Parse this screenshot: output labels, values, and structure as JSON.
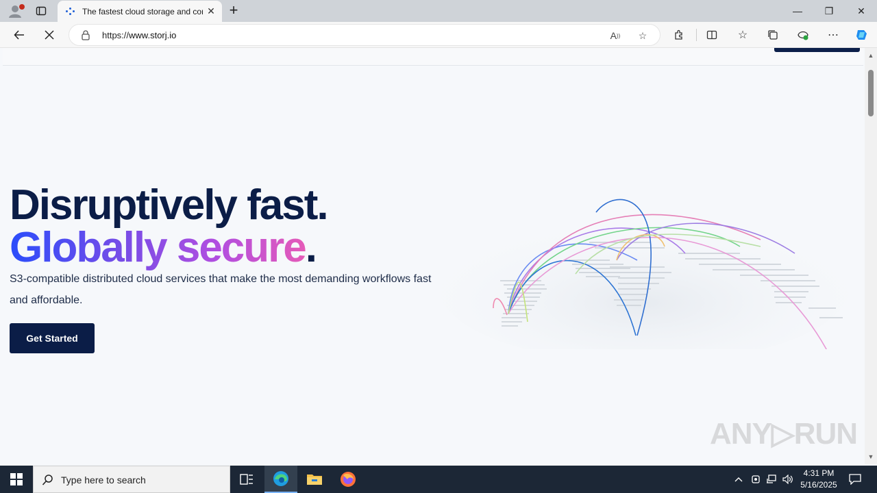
{
  "browser": {
    "tab": {
      "title": "The fastest cloud storage and cor"
    },
    "address": {
      "prefix": "https://",
      "host": "www.storj.io"
    },
    "window": {
      "minimize": "—",
      "maximize": "❐",
      "close": "✕"
    }
  },
  "page": {
    "hero": {
      "line1": "Disruptively fast.",
      "line2_grad": "Globally secure",
      "line2_dot": ".",
      "subtitle": "S3-compatible distributed cloud services that make the most demanding workflows fast and affordable.",
      "cta": "Get Started"
    },
    "watermark": "ANY▷RUN"
  },
  "taskbar": {
    "search_placeholder": "Type here to search",
    "time": "4:31 PM",
    "date": "5/16/2025"
  },
  "colors": {
    "navy": "#0b1d47",
    "gradient_start": "#2b4dfb",
    "gradient_end": "#e55bb8"
  }
}
